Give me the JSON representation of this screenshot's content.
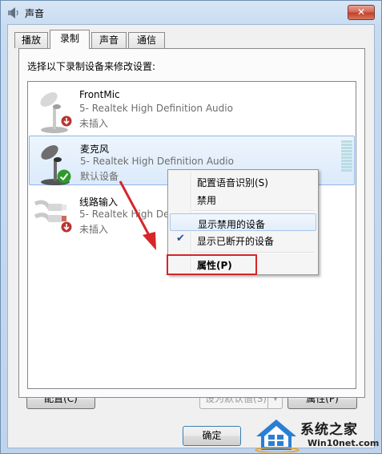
{
  "window": {
    "title": "声音",
    "close_glyph": "✕"
  },
  "tabs": [
    {
      "label": "播放"
    },
    {
      "label": "录制",
      "active": true
    },
    {
      "label": "声音"
    },
    {
      "label": "通信"
    }
  ],
  "panel": {
    "instruction": "选择以下录制设备来修改设置:"
  },
  "devices": [
    {
      "name": "FrontMic",
      "driver": "5- Realtek High Definition Audio",
      "status": "未插入",
      "icon": "microphone-icon",
      "badge": "unplugged-badge-icon"
    },
    {
      "name": "麦克风",
      "driver": "5- Realtek High Definition Audio",
      "status": "默认设备",
      "icon": "microphone-icon",
      "badge": "default-check-icon",
      "selected": true
    },
    {
      "name": "线路输入",
      "driver": "5- Realtek High Definition Audio",
      "status": "未插入",
      "icon": "line-in-cable-icon",
      "badge": "unplugged-badge-icon"
    }
  ],
  "context_menu": {
    "items": [
      {
        "label": "配置语音识别(S)"
      },
      {
        "label": "禁用"
      },
      {
        "label": "显示禁用的设备",
        "hover": true
      },
      {
        "label": "显示已断开的设备",
        "checked": true
      },
      {
        "label": "属性(P)"
      }
    ],
    "check_glyph": "✔"
  },
  "buttons": {
    "configure": "配置(C)",
    "set_default": "设为默认值(S)",
    "set_default_arrow": "▼",
    "properties": "属性(P)",
    "ok": "确定"
  },
  "watermark": {
    "title": "系统之家",
    "url": "Win10net.com"
  },
  "colors": {
    "annotation_red": "#d6262a",
    "selection_blue": "#dbeafb",
    "default_green": "#2f9a2a"
  }
}
